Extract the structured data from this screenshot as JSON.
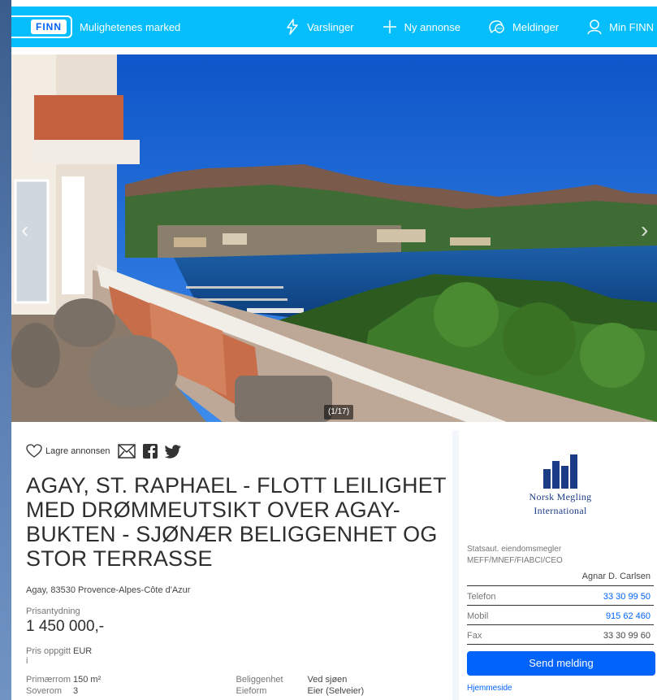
{
  "header": {
    "logo": "FINN",
    "tagline": "Mulighetenes marked",
    "nav": [
      {
        "label": "Varslinger",
        "icon": "bolt-icon"
      },
      {
        "label": "Ny annonse",
        "icon": "plus-icon"
      },
      {
        "label": "Meldinger",
        "icon": "chat-icon"
      },
      {
        "label": "Min FINN",
        "icon": "user-icon"
      }
    ]
  },
  "gallery": {
    "counter": "(1/17)",
    "prev": "‹",
    "next": "›"
  },
  "listing": {
    "save_label": "Lagre annonsen",
    "title": "AGAY, ST. RAPHAEL - FLOTT LEILIGHET MED DRØMMEUTSIKT OVER AGAY-BUKTEN - SJØNÆR BELIGGENHET OG STOR TERRASSE",
    "address": "Agay, 83530 Provence-Alpes-Côte d'Azur",
    "price_label": "Prisantydning",
    "price": "1 450 000,-",
    "currency_label": "Pris oppgitt i",
    "currency": "EUR",
    "facts_left": [
      {
        "label": "Primærrom",
        "value": "150 m²"
      },
      {
        "label": "Soverom",
        "value": "3"
      }
    ],
    "facts_right": [
      {
        "label": "Beliggenhet",
        "value": "Ved sjøen"
      },
      {
        "label": "Eieform",
        "value": "Eier (Selveier)"
      }
    ]
  },
  "broker": {
    "logo_line1": "Norsk Megling",
    "logo_line2": "International",
    "title_line1": "Statsaut. eiendomsmegler",
    "title_line2": "MEFF/MNEF/FIABCI/CEO",
    "agent": "Agnar D. Carlsen",
    "contacts": [
      {
        "label": "Telefon",
        "value": "33 30 99 50"
      },
      {
        "label": "Mobil",
        "value": "915 62 460"
      },
      {
        "label": "Fax",
        "value": "33 30 99 60"
      }
    ],
    "send_label": "Send melding",
    "homepage_label": "Hjemmeside"
  },
  "colors": {
    "brand": "#06befb",
    "link": "#0063fb"
  }
}
